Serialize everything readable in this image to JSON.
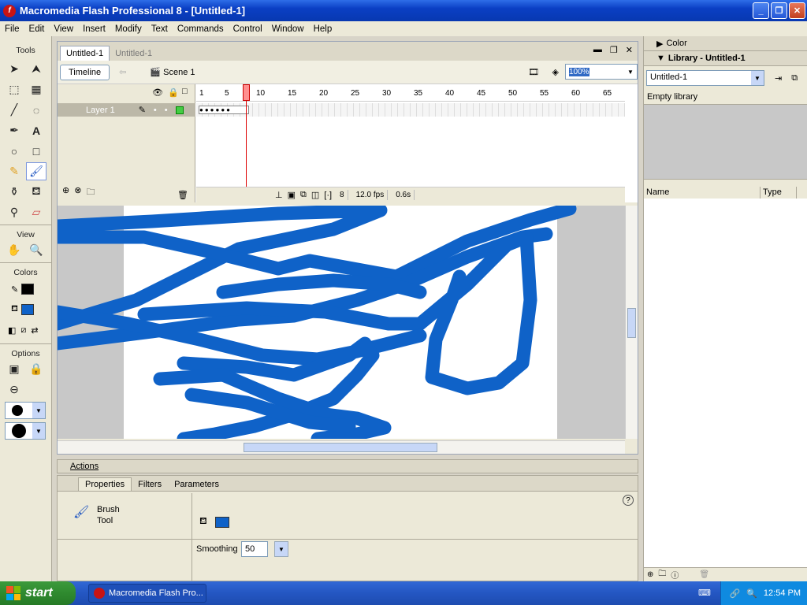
{
  "window": {
    "title": "Macromedia Flash Professional 8 - [Untitled-1]",
    "logo": "f"
  },
  "menu": [
    "File",
    "Edit",
    "View",
    "Insert",
    "Modify",
    "Text",
    "Commands",
    "Control",
    "Window",
    "Help"
  ],
  "tools": {
    "header": "Tools",
    "view_label": "View",
    "colors_label": "Colors",
    "options_label": "Options",
    "stroke_color": "#000000",
    "fill_color": "#0f62c8"
  },
  "document": {
    "tabs": [
      "Untitled-1",
      "Untitled-1"
    ],
    "timeline_button": "Timeline",
    "scene": "Scene 1",
    "zoom": "100%"
  },
  "timeline": {
    "layer_name": "Layer 1",
    "frame_numbers": [
      "1",
      "5",
      "10",
      "15",
      "20",
      "25",
      "30",
      "35",
      "40",
      "45",
      "50",
      "55",
      "60",
      "65"
    ],
    "current_frame": "8",
    "fps": "12.0 fps",
    "elapsed": "0.6s"
  },
  "panels": {
    "actions": "Actions",
    "tabs": [
      "Properties",
      "Filters",
      "Parameters"
    ],
    "tool_name_line1": "Brush",
    "tool_name_line2": "Tool",
    "smoothing_label": "Smoothing",
    "smoothing_value": "50",
    "help": "?"
  },
  "right": {
    "color_header": "Color",
    "library_header": "Library - Untitled-1",
    "library_select": "Untitled-1",
    "empty_text": "Empty library",
    "col_name": "Name",
    "col_type": "Type"
  },
  "taskbar": {
    "start": "start",
    "task": "Macromedia Flash Pro...",
    "clock": "12:54 PM"
  }
}
